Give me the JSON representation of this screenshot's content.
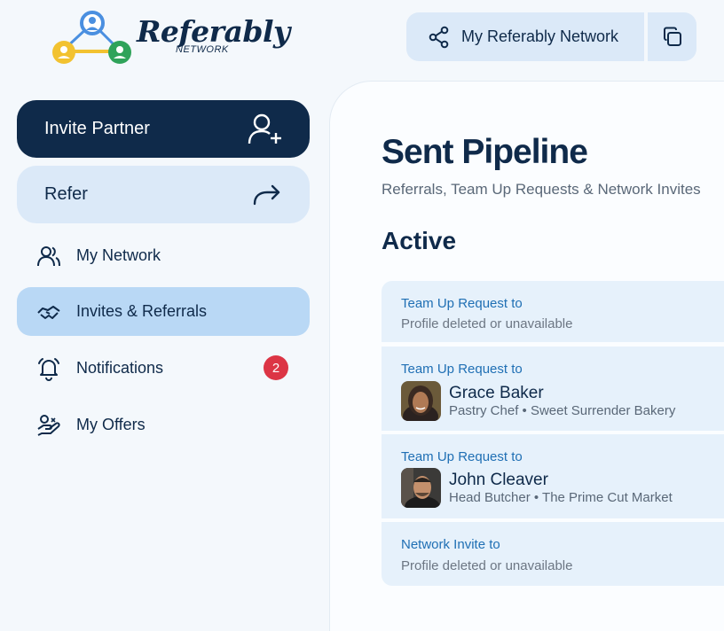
{
  "brand": {
    "name": "Referably",
    "sub": "NETWORK"
  },
  "header": {
    "network_button": "My Referably Network"
  },
  "sidebar": {
    "invite_label": "Invite Partner",
    "refer_label": "Refer",
    "items": [
      {
        "label": "My Network"
      },
      {
        "label": "Invites & Referrals"
      },
      {
        "label": "Notifications",
        "badge": "2"
      },
      {
        "label": "My Offers"
      }
    ]
  },
  "main": {
    "title": "Sent Pipeline",
    "subtitle": "Referrals, Team Up Requests & Network Invites",
    "section_title": "Active",
    "cards": [
      {
        "type": "Team Up Request to",
        "detail": "Profile deleted or unavailable"
      },
      {
        "type": "Team Up Request to",
        "name": "Grace Baker",
        "role": "Pastry Chef • Sweet Surrender Bakery"
      },
      {
        "type": "Team Up Request to",
        "name": "John Cleaver",
        "role": "Head Butcher • The Prime Cut Market"
      },
      {
        "type": "Network Invite to",
        "detail": "Profile deleted or unavailable"
      }
    ]
  },
  "colors": {
    "navy": "#0f2a4a",
    "light_blue": "#dbe9f8",
    "active_blue": "#b9d8f5",
    "badge_red": "#dc3545",
    "link_blue": "#1f6fb4"
  }
}
